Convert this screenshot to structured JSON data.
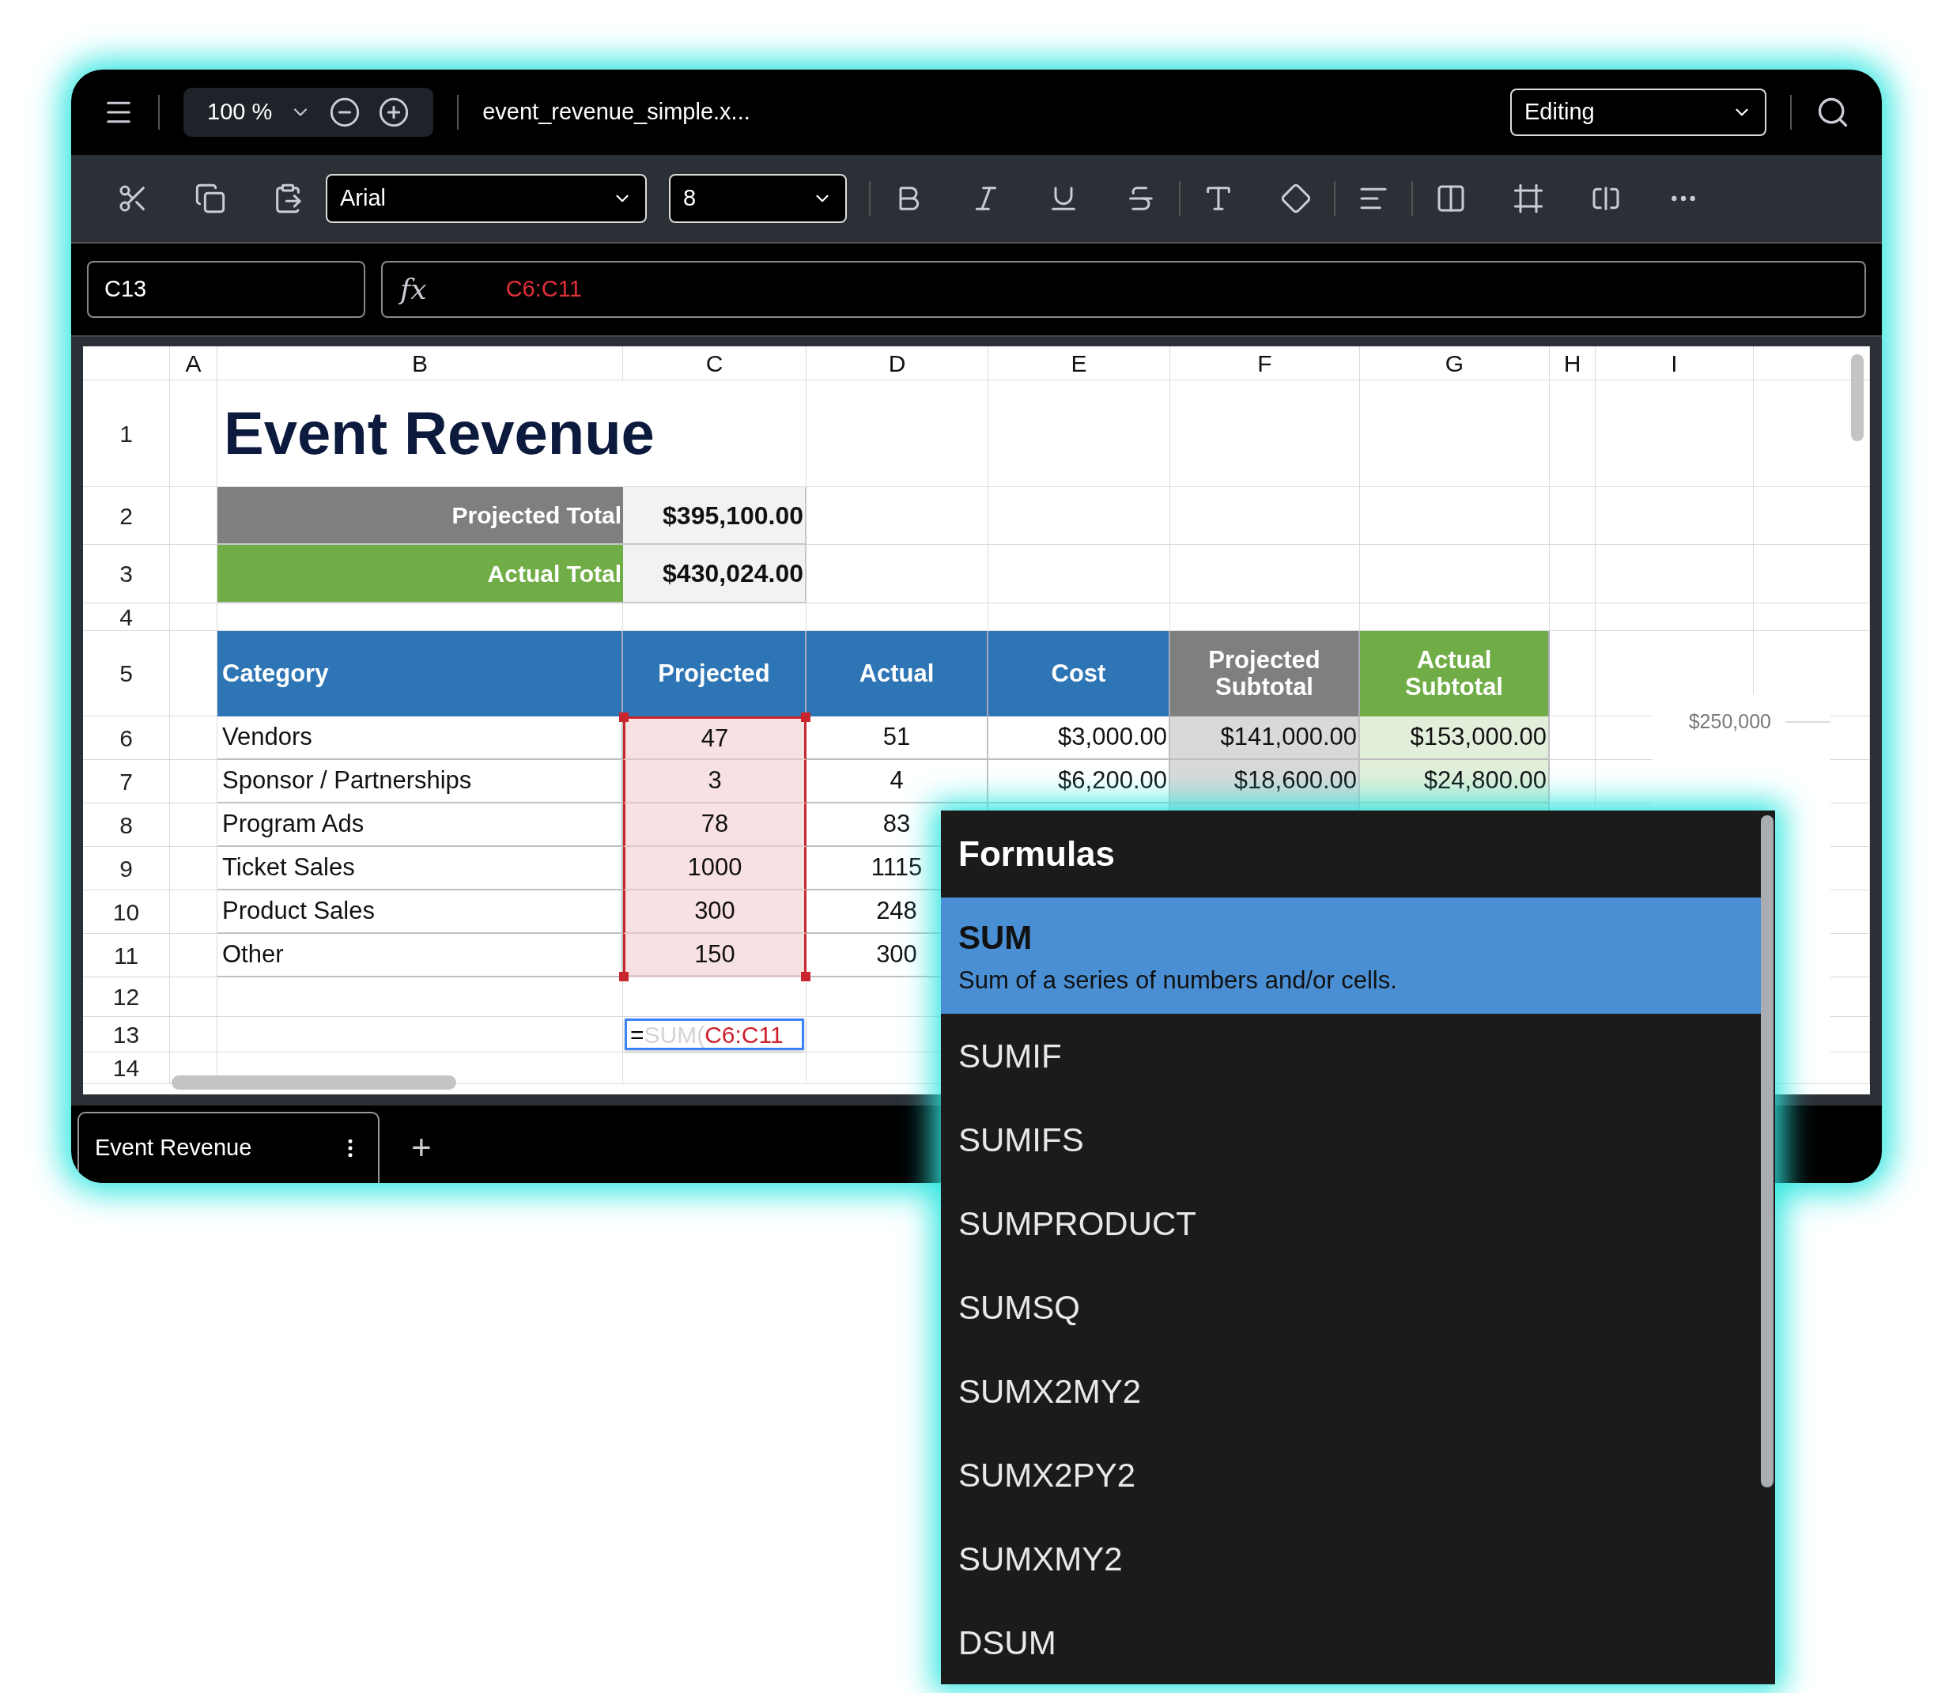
{
  "top_bar": {
    "zoom": "100 %",
    "file_name": "event_revenue_simple.x...",
    "mode": "Editing"
  },
  "toolbar": {
    "font": "Arial",
    "font_size": "8"
  },
  "formula_bar": {
    "name_box": "C13",
    "function_label": "fx",
    "formula": "C6:C11"
  },
  "sheet": {
    "columns": [
      "A",
      "B",
      "C",
      "D",
      "E",
      "F",
      "G",
      "H",
      "I"
    ],
    "row_numbers": [
      "1",
      "2",
      "3",
      "4",
      "5",
      "6",
      "7",
      "8",
      "9",
      "10",
      "11",
      "12",
      "13",
      "14"
    ],
    "title": "Event Revenue",
    "totals": [
      {
        "label": "Projected Total",
        "value": "$395,100.00",
        "kind": "projected"
      },
      {
        "label": "Actual Total",
        "value": "$430,024.00",
        "kind": "actual"
      }
    ],
    "header": [
      {
        "text": "Category",
        "kind": "blue"
      },
      {
        "text": "Projected",
        "kind": "blue"
      },
      {
        "text": "Actual",
        "kind": "blue"
      },
      {
        "text": "Cost",
        "kind": "blue"
      },
      {
        "text": "Projected Subtotal",
        "kind": "gray"
      },
      {
        "text": "Actual Subtotal",
        "kind": "green"
      }
    ],
    "rows": [
      {
        "category": "Vendors",
        "projected": "47",
        "actual": "51",
        "cost": "$3,000.00",
        "projected_subtotal": "$141,000.00",
        "actual_subtotal": "$153,000.00",
        "in_range": true
      },
      {
        "category": "Sponsor / Partnerships",
        "projected": "3",
        "actual": "4",
        "cost": "$6,200.00",
        "projected_subtotal": "$18,600.00",
        "actual_subtotal": "$24,800.00",
        "in_range": true
      },
      {
        "category": "Program Ads",
        "projected": "78",
        "actual": "83",
        "in_range": true
      },
      {
        "category": "Ticket Sales",
        "projected": "1000",
        "actual": "1115",
        "in_range": true
      },
      {
        "category": "Product Sales",
        "projected": "300",
        "actual": "248",
        "in_range": true
      },
      {
        "category": "Other",
        "projected": "150",
        "actual": "300",
        "in_range": true
      }
    ],
    "cell_editor": {
      "equals": "=",
      "hint": "SUM(",
      "reference": "C6:C11"
    },
    "chart_axis_labels": [
      "$250,000"
    ]
  },
  "sheet_tabs": [
    {
      "label": "Event Revenue",
      "selected": true
    }
  ],
  "add_sheet": "+",
  "formula_menu": {
    "title": "Formulas",
    "items": [
      {
        "name": "SUM",
        "description": "Sum of a series of numbers and/or cells.",
        "selected": true
      },
      {
        "name": "SUMIF",
        "selected": false
      },
      {
        "name": "SUMIFS",
        "selected": false
      },
      {
        "name": "SUMPRODUCT",
        "selected": false
      },
      {
        "name": "SUMSQ",
        "selected": false
      },
      {
        "name": "SUMX2MY2",
        "selected": false
      },
      {
        "name": "SUMX2PY2",
        "selected": false
      },
      {
        "name": "SUMXMY2",
        "selected": false
      },
      {
        "name": "DSUM",
        "selected": false
      }
    ]
  }
}
